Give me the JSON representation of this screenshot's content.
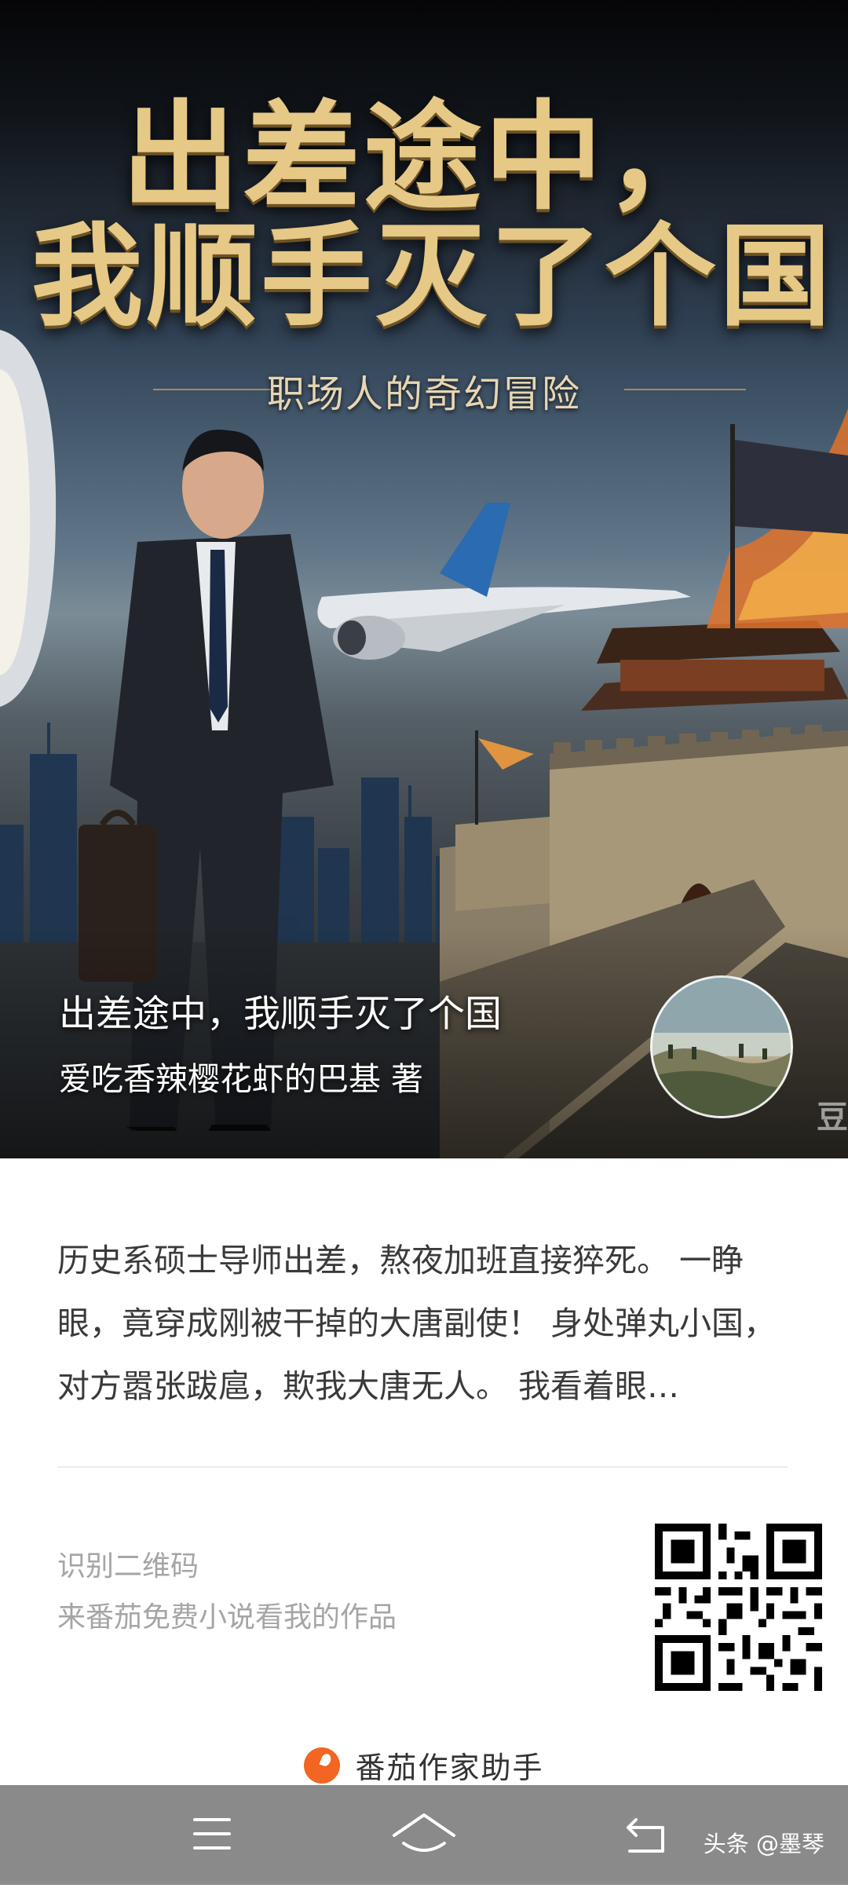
{
  "cover": {
    "title_line1": "出差途中，",
    "title_line2": "我顺手灭了个国",
    "subtitle": "职场人的奇幻冒险",
    "corner_watermark": "豆"
  },
  "book": {
    "title": "出差途中，我顺手灭了个国",
    "author": "爱吃香辣樱花虾的巴基 著",
    "synopsis": "历史系硕士导师出差，熬夜加班直接猝死。 一睁眼，竟穿成刚被干掉的大唐副使！ 身处弹丸小国，对方嚣张跋扈，欺我大唐无人。 我看着眼…"
  },
  "qr": {
    "hint_line1": "识别二维码",
    "hint_line2": "来番茄免费小说看我的作品"
  },
  "brand": {
    "name": "番茄作家助手",
    "accent_color": "#f26522"
  },
  "nav": {
    "menu_icon": "menu-icon",
    "home_icon": "home-icon",
    "back_icon": "back-icon",
    "watermark": "头条 @墨琴"
  }
}
